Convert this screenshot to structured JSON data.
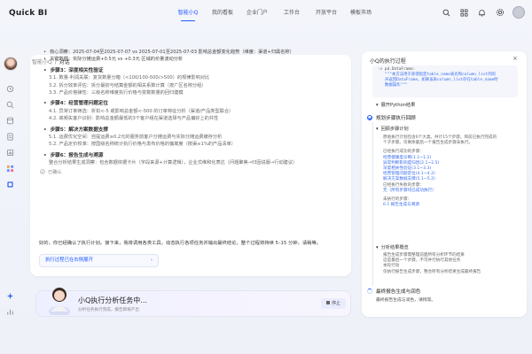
{
  "app": {
    "logo_text": "Quick BI"
  },
  "nav": {
    "items": [
      {
        "label": "智能小Q",
        "active": true
      },
      {
        "label": "我的看板",
        "active": false
      },
      {
        "label": "企业门户",
        "active": false
      },
      {
        "label": "工作台",
        "active": false
      },
      {
        "label": "开放平台",
        "active": false
      },
      {
        "label": "模板市场",
        "active": false
      }
    ]
  },
  "breadcrumb": {
    "root": "智能小Q",
    "separator": "/",
    "current": "对话"
  },
  "main": {
    "lines": [
      {
        "type": "bullet",
        "text": "核心洞察：2025-07-04至2025-07-07 vs 2025-07-01至2025-07-03 影响总金额变化趋势（维度：渠道+归属名称）"
      },
      {
        "type": "bullet",
        "text": "关键数据：实际分摊运费+0.5元 vs +0.3元 区域的价量波动分析"
      },
      {
        "type": "step",
        "text": "步骤3：深度相关性验证"
      },
      {
        "type": "sub",
        "text": "3.1. 数量-利润关联：复货数量分箱（<100/100-500/>500）的规律影响对比"
      },
      {
        "type": "sub",
        "text": "3.2. 拆分效率评估：拆分最初与结算金额的相关系数计算（按广区名称分组）"
      },
      {
        "type": "sub",
        "text": "3.3. 产品价格弹性：三级名称维度执行价格与变数数量的回归建模"
      },
      {
        "type": "step",
        "text": "步骤4：经营管理问题定位"
      },
      {
        "type": "sub",
        "text": "4.1. 异常订单筛选：折扣<-5 或影响总金额<-500 的订单特征分析（渠道/产品类型联合）"
      },
      {
        "type": "sub",
        "text": "4.2. 高频失客户识别：影响总金额最低的3个客户组在渠道选择与产品偏好上的共性"
      },
      {
        "type": "step",
        "text": "步骤5：解决方案数据支撑"
      },
      {
        "type": "sub",
        "text": "5.1. 运费优化空间：自提运费≥0.2元的服务前客户分摊运费与实际分摊运费缓存分析"
      },
      {
        "type": "sub",
        "text": "5.2. 产品定价校准：按国级名称统计执行价格与发布价格的偏离度（按渠≥1%的产品清单）"
      },
      {
        "type": "step",
        "text": "步骤6：报告生成与溯源"
      },
      {
        "type": "sub-plain",
        "text": "整合分析结果生成洞察：包含数据依据卡片（字段来源+计算逻辑），企业式维和化表达（问题聚焦→归因说服→行动建议）"
      }
    ],
    "copy_label": "已确认",
    "summary": "好的，你已经确认了执行计划。接下来，我将调用各类工具，动态执行各项任务并输出最终结论。整个过程将持续 5–15 分钟，请稍等。",
    "exec_link_label": "执行过程已在右侧展开",
    "exec_link_arrow": "›"
  },
  "status": {
    "title": "小Q执行分析任务中...",
    "subtitle": "分析任务执行完成，报告即将产出",
    "stop_label": "停止"
  },
  "panel": {
    "title": "小Q的执行过程",
    "close": "×",
    "code_lines": [
      "-> pd.DataFrame:",
      "\"\"\"本方法用于获得指定table_name表名和column_list列的",
      "开返回DataFrame。如果该表column_list存在table_name时",
      "数据操作\"\"\""
    ],
    "python_result_label": "展开Python结果",
    "section1": "规划步骤执行回顾",
    "sub1": "回顾步骤计划",
    "review_lines": [
      "原始执行计划包含6个大类。共计15个步骤。目前已执行完成的",
      "个子步骤。仅剩余最后一个报告生成步骤未执行。"
    ],
    "done_head": "已经执行成功的步骤：",
    "done_lines": [
      "经营健康度诊断(1.1~1.2)",
      "异常判断影响度归因(2.1~2.5)",
      "深度相关性验证(3.1~3.3)",
      "经营管理问题定位(4.1~4.2)",
      "解决方案数据支撑(5.1~5.2)",
      "已经执行失败的步骤：",
      "无（所有步骤均已成功执行）"
    ],
    "pending_head": "未执行的步骤：",
    "pending_lines": [
      "6.1 报告生成与溯源"
    ],
    "sub2": "分析结果概览",
    "result_lines": [
      "报告生成步骤需整理前面所有分析环节的结果",
      "这是最后一个步骤，不可并行执行其他任务",
      "本轮行动",
      "仅执行报告生成步骤，整合所有分析结果生成最终报告"
    ],
    "section2": "最终报告生成与润色",
    "final_line": "最终报告生成与润色，请稍等。"
  }
}
